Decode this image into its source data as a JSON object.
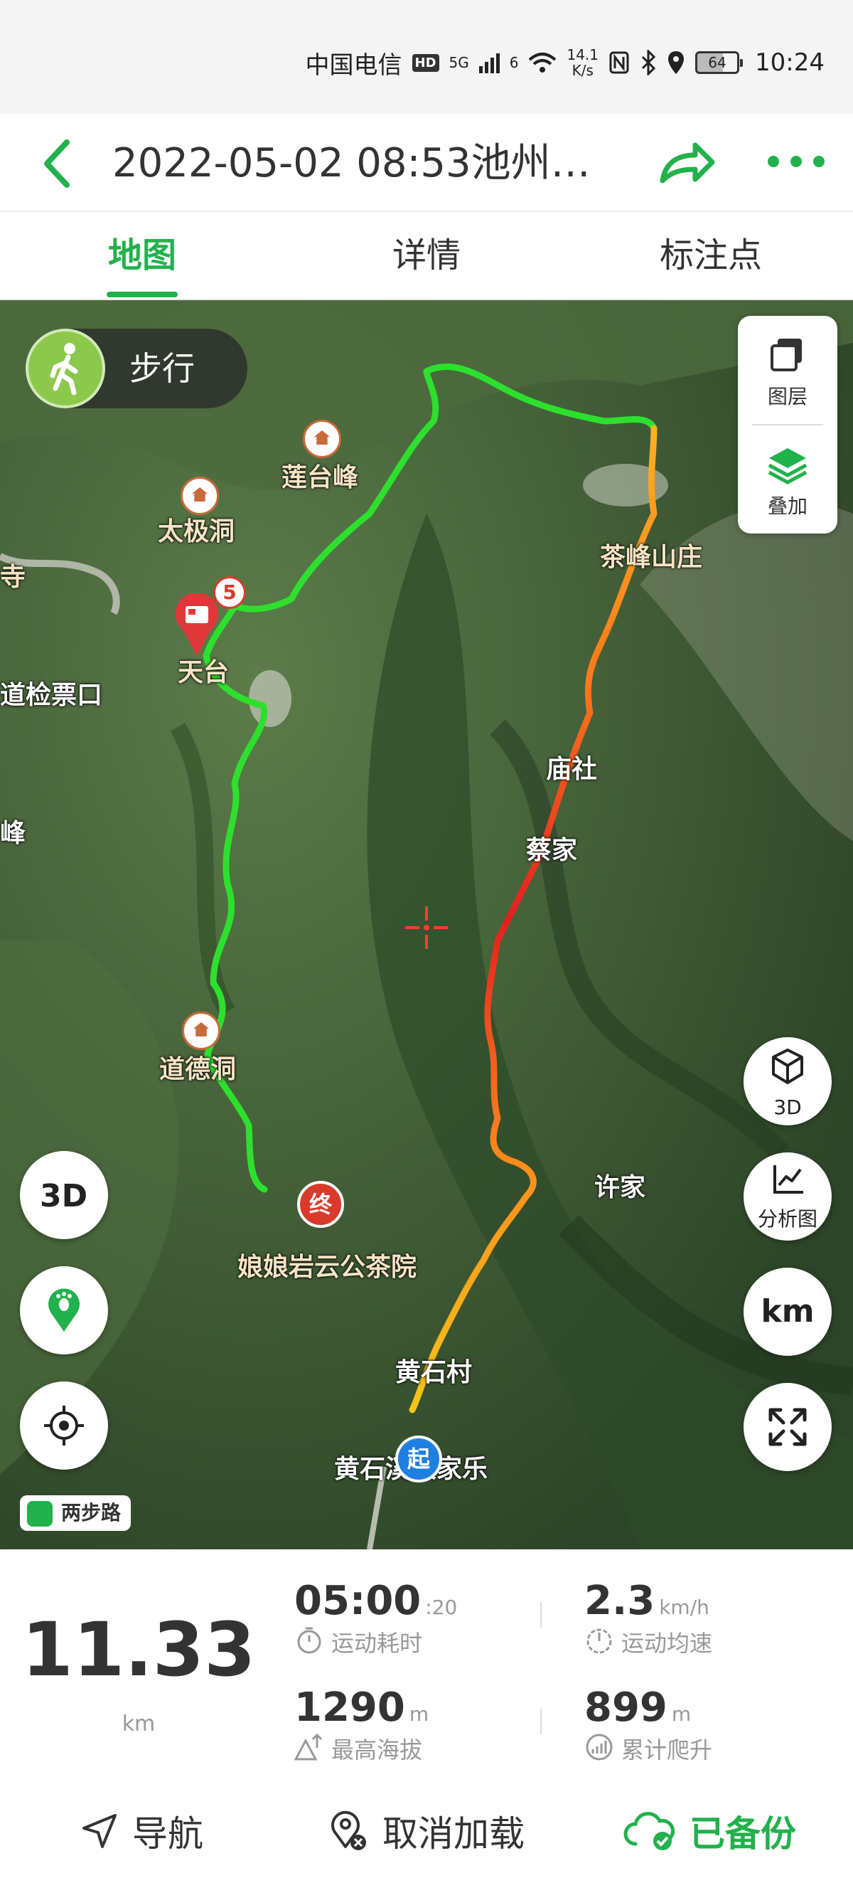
{
  "status_bar": {
    "carrier": "中国电信",
    "hd": "HD",
    "net_5g": "5G",
    "net_6": "6",
    "speed_value": "14.1",
    "speed_unit": "K/s",
    "battery": "64",
    "time": "10:24"
  },
  "header": {
    "title": "2022-05-02 08:53池州…",
    "back_icon": "chevron-left-icon",
    "share_icon": "share-icon",
    "more_icon": "more-dots-icon",
    "accent_color": "#22b14c"
  },
  "tabs": [
    {
      "label": "地图",
      "active": true
    },
    {
      "label": "详情",
      "active": false
    },
    {
      "label": "标注点",
      "active": false
    }
  ],
  "map": {
    "mode_label": "步行",
    "layer_panel": {
      "layers_label": "图层",
      "overlay_label": "叠加"
    },
    "right_buttons": {
      "three_d": "3D",
      "analysis": "分析图",
      "unit": "km"
    },
    "photo_count": "5",
    "pins": {
      "end": "终",
      "start": "起"
    },
    "labels": {
      "lotus_peak": "莲台峰",
      "taiji_cave": "太极洞",
      "tian_tai": "天台",
      "ticket_gate": "道检票口",
      "si": "寺",
      "feng": "峰",
      "tea_villa": "茶峰山庄",
      "miao_she": "庙社",
      "cai_jia": "蔡家",
      "daode_cave": "道德洞",
      "xu_jia": "许家",
      "niangniang": "娘娘岩云公茶院",
      "huangshi_village": "黄石村",
      "huangshi_farm": "黄石溪农家乐"
    },
    "badge_2bu": "两步路"
  },
  "stats": {
    "distance": "11.33",
    "distance_unit": "km",
    "duration_main": "05:00",
    "duration_sec": ":20",
    "duration_label": "运动耗时",
    "speed": "2.3",
    "speed_unit": "km/h",
    "speed_label": "运动均速",
    "max_alt": "1290",
    "max_alt_unit": "m",
    "max_alt_label": "最高海拔",
    "climb": "899",
    "climb_unit": "m",
    "climb_label": "累计爬升"
  },
  "actions": {
    "navigate": "导航",
    "cancel_load": "取消加载",
    "backed_up": "已备份"
  }
}
